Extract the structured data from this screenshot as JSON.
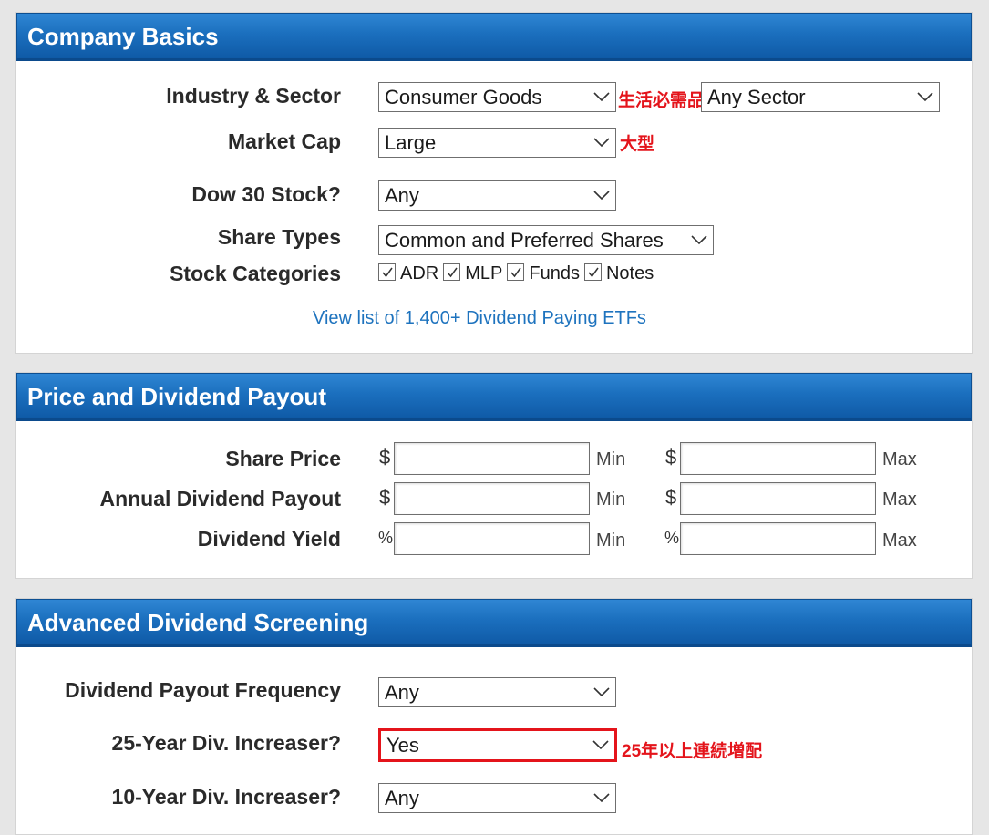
{
  "company_basics": {
    "title": "Company Basics",
    "industry_label": "Industry & Sector",
    "industry_value": "Consumer Goods",
    "industry_note": "生活必需品",
    "sector_value": "Any Sector",
    "market_cap_label": "Market Cap",
    "market_cap_value": "Large",
    "market_cap_note": "大型",
    "dow30_label": "Dow 30 Stock?",
    "dow30_value": "Any",
    "share_types_label": "Share Types",
    "share_types_value": "Common and Preferred Shares",
    "stock_categories_label": "Stock Categories",
    "categories": [
      {
        "label": "ADR",
        "checked": true
      },
      {
        "label": "MLP",
        "checked": true
      },
      {
        "label": "Funds",
        "checked": true
      },
      {
        "label": "Notes",
        "checked": true
      }
    ],
    "etf_link": "View list of 1,400+ Dividend Paying ETFs"
  },
  "price_payout": {
    "title": "Price and Dividend Payout",
    "rows": [
      {
        "label": "Share Price",
        "symbol": "$",
        "min_label": "Min",
        "max_label": "Max",
        "min_value": "",
        "max_value": ""
      },
      {
        "label": "Annual Dividend Payout",
        "symbol": "$",
        "min_label": "Min",
        "max_label": "Max",
        "min_value": "",
        "max_value": ""
      },
      {
        "label": "Dividend Yield",
        "symbol": "%",
        "min_label": "Min",
        "max_label": "Max",
        "min_value": "",
        "max_value": ""
      }
    ]
  },
  "advanced": {
    "title": "Advanced Dividend Screening",
    "frequency_label": "Dividend Payout Frequency",
    "frequency_value": "Any",
    "inc25_label": "25-Year Div. Increaser?",
    "inc25_value": "Yes",
    "inc25_note": "25年以上連続増配",
    "inc10_label": "10-Year Div. Increaser?",
    "inc10_value": "Any"
  },
  "colors": {
    "header_blue": "#1b6fbe",
    "annotation_red": "#e4141b",
    "link_blue": "#1e73be"
  }
}
